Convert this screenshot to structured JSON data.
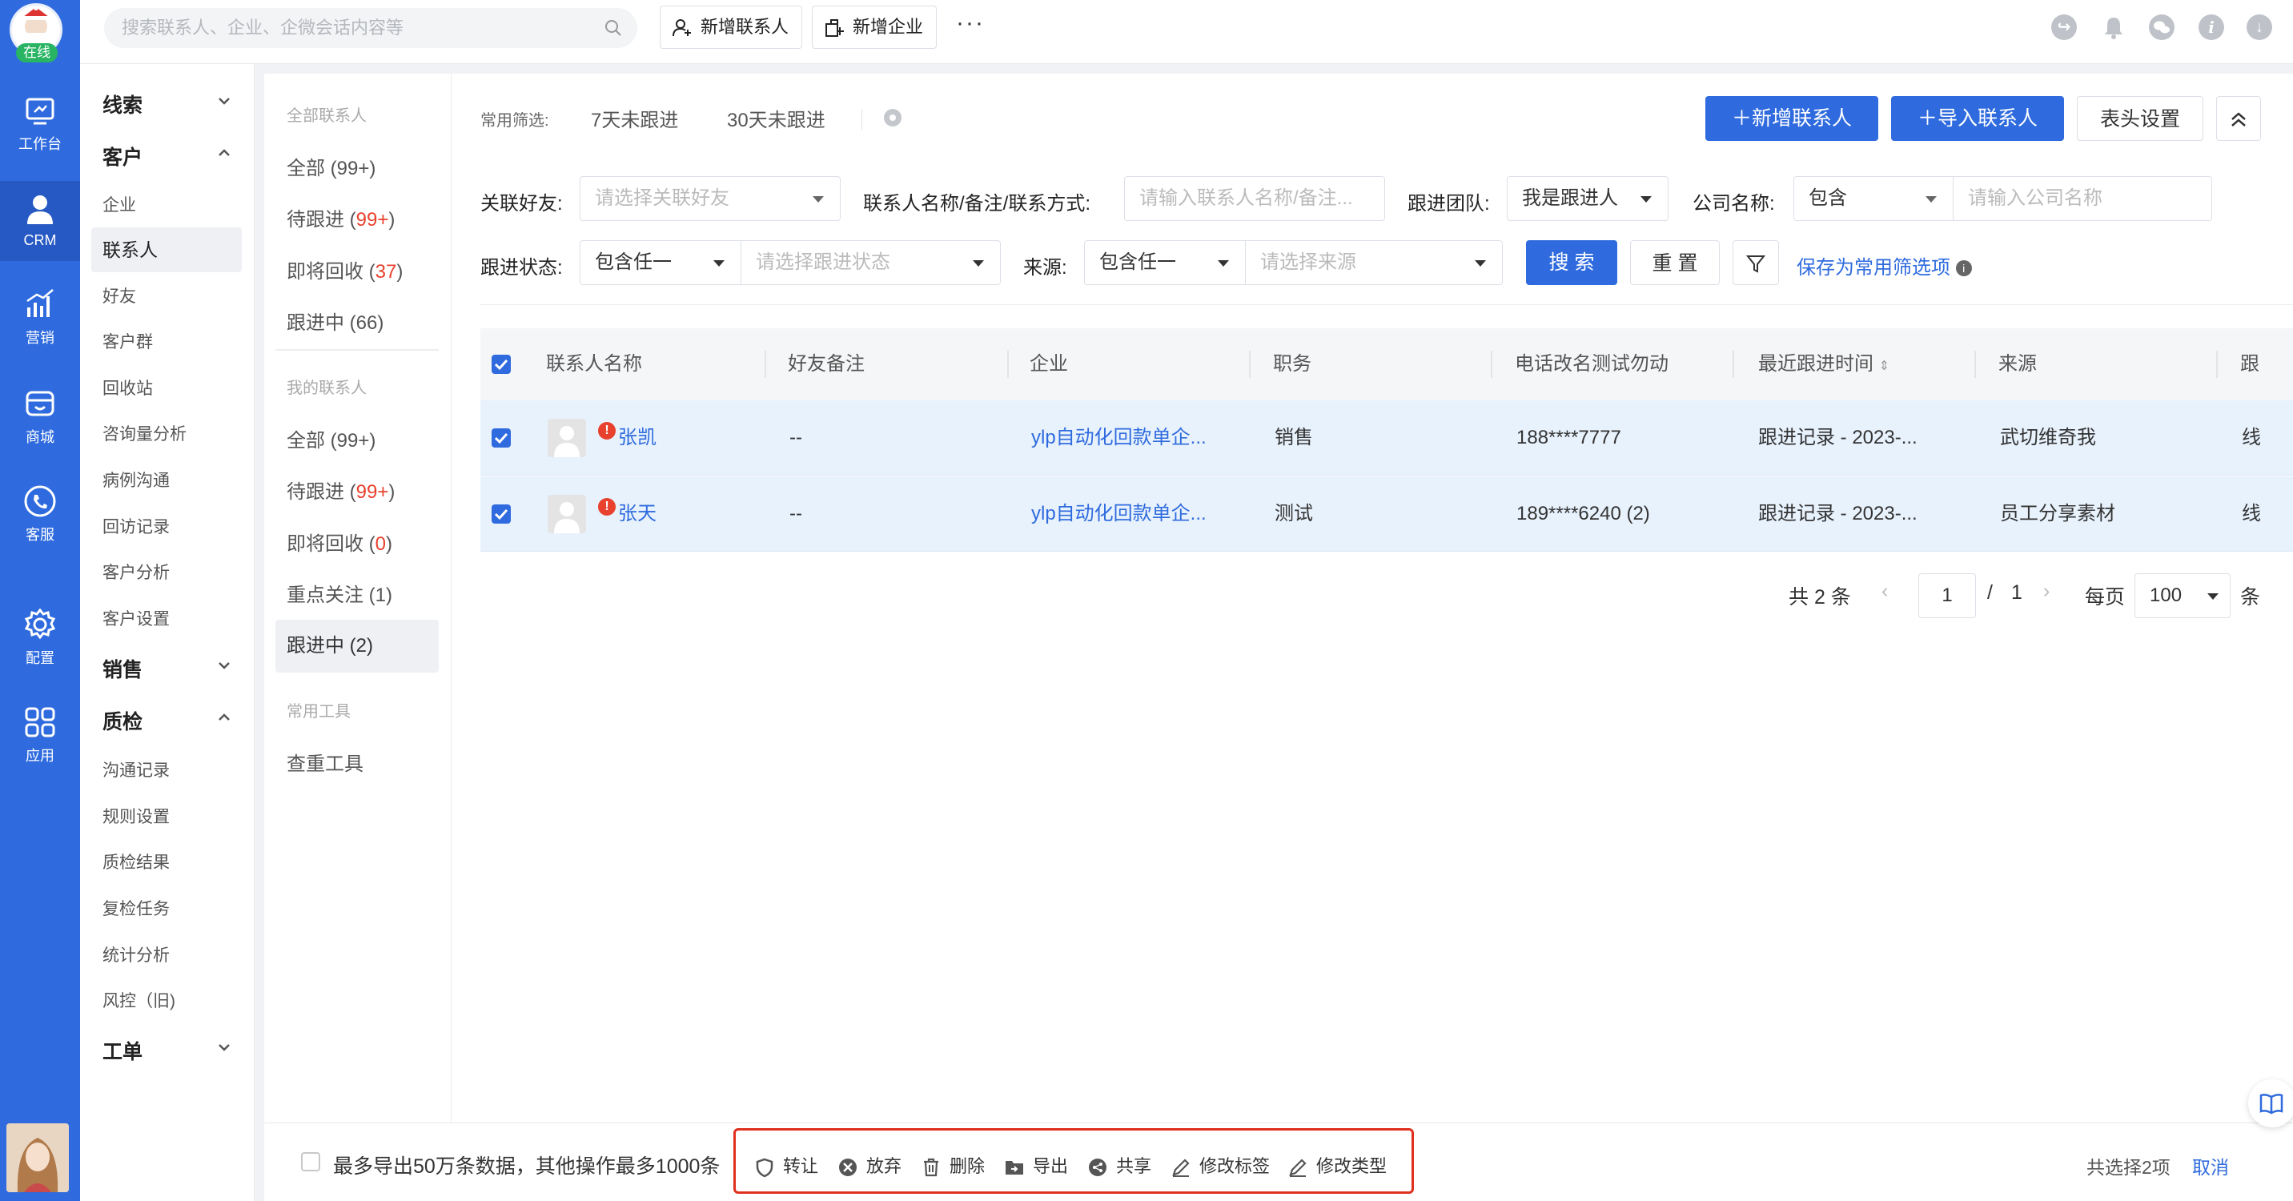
{
  "rail": {
    "status": "在线",
    "items": [
      {
        "label": "工作台",
        "icon": "workbench-icon"
      },
      {
        "label": "CRM",
        "icon": "person-icon"
      },
      {
        "label": "营销",
        "icon": "chart-icon"
      },
      {
        "label": "商城",
        "icon": "store-icon"
      },
      {
        "label": "客服",
        "icon": "phone-icon"
      },
      {
        "label": "配置",
        "icon": "gear-icon"
      },
      {
        "label": "应用",
        "icon": "grid-icon"
      }
    ]
  },
  "topbar": {
    "search_placeholder": "搜索联系人、企业、企微会话内容等",
    "add_contact": "新增联系人",
    "add_company": "新增企业",
    "more": "···"
  },
  "sidebar": {
    "groups": [
      {
        "label": "线索"
      },
      {
        "label": "客户"
      },
      {
        "label": "销售"
      },
      {
        "label": "质检"
      },
      {
        "label": "工单"
      }
    ],
    "customer_items": [
      "企业",
      "联系人",
      "好友",
      "客户群",
      "回收站",
      "咨询量分析",
      "病例沟通",
      "回访记录",
      "客户分析",
      "客户设置"
    ],
    "qc_items": [
      "沟通记录",
      "规则设置",
      "质检结果",
      "复检任务",
      "统计分析",
      "风控（旧)"
    ]
  },
  "views": {
    "all_header": "全部联系人",
    "all": {
      "label": "全部",
      "count": "(99+)"
    },
    "pending": {
      "label": "待跟进",
      "open": "(",
      "count": "99+",
      "close": ")"
    },
    "recycle": {
      "label": "即将回收",
      "open": "(",
      "count": "37",
      "close": ")"
    },
    "following": {
      "label": "跟进中",
      "count": "(66)"
    },
    "my_header": "我的联系人",
    "my_all": {
      "label": "全部",
      "count": "(99+)"
    },
    "my_pending": {
      "label": "待跟进",
      "open": "(",
      "count": "99+",
      "close": ")"
    },
    "my_recycle": {
      "label": "即将回收",
      "open": "(",
      "count": "0",
      "close": ")"
    },
    "my_focus": {
      "label": "重点关注",
      "count": "(1)"
    },
    "my_following": {
      "label": "跟进中",
      "count": "(2)"
    },
    "tools_header": "常用工具",
    "dedup": "查重工具"
  },
  "filters": {
    "common_label": "常用筛选:",
    "quick1": "7天未跟进",
    "quick2": "30天未跟进",
    "btn_new": "新增联系人",
    "btn_import": "导入联系人",
    "btn_columns": "表头设置",
    "friend_label": "关联好友:",
    "friend_ph": "请选择关联好友",
    "name_label": "联系人名称/备注/联系方式:",
    "name_ph": "请输入联系人名称/备注...",
    "team_label": "跟进团队:",
    "team_val": "我是跟进人",
    "company_label": "公司名称:",
    "company_op": "包含",
    "company_ph": "请输入公司名称",
    "status_label": "跟进状态:",
    "status_op": "包含任一",
    "status_ph": "请选择跟进状态",
    "source_label": "来源:",
    "source_op": "包含任一",
    "source_ph": "请选择来源",
    "search": "搜 索",
    "reset": "重 置",
    "save": "保存为常用筛选项"
  },
  "table": {
    "columns": [
      "联系人名称",
      "好友备注",
      "企业",
      "职务",
      "电话改名测试勿动",
      "最近跟进时间",
      "来源",
      "跟"
    ],
    "rows": [
      {
        "name": "张凯",
        "remark": "--",
        "company": "ylp自动化回款单企...",
        "title": "销售",
        "phone": "188****7777",
        "last": "跟进记录 - 2023-...",
        "source": "武切维奇我",
        "extra": "线"
      },
      {
        "name": "张天",
        "remark": "--",
        "company": "ylp自动化回款单企...",
        "title": "测试",
        "phone": "189****6240 (2)",
        "last": "跟进记录 - 2023-...",
        "source": "员工分享素材",
        "extra": "线"
      }
    ]
  },
  "pagination": {
    "total": "共 2 条",
    "page": "1",
    "slash": "/",
    "pages": "1",
    "per_label": "每页",
    "per": "100",
    "unit": "条"
  },
  "bottom": {
    "export_note": "最多导出50万条数据，其他操作最多1000条",
    "actions": [
      "转让",
      "放弃",
      "删除",
      "导出",
      "共享",
      "修改标签",
      "修改类型"
    ],
    "selected": "共选择2项",
    "cancel": "取消"
  },
  "colors": {
    "primary": "#2f6bde",
    "row_selected": "#e8f2fd",
    "warn": "#e8412d",
    "highlight_box": "#e0301e"
  }
}
